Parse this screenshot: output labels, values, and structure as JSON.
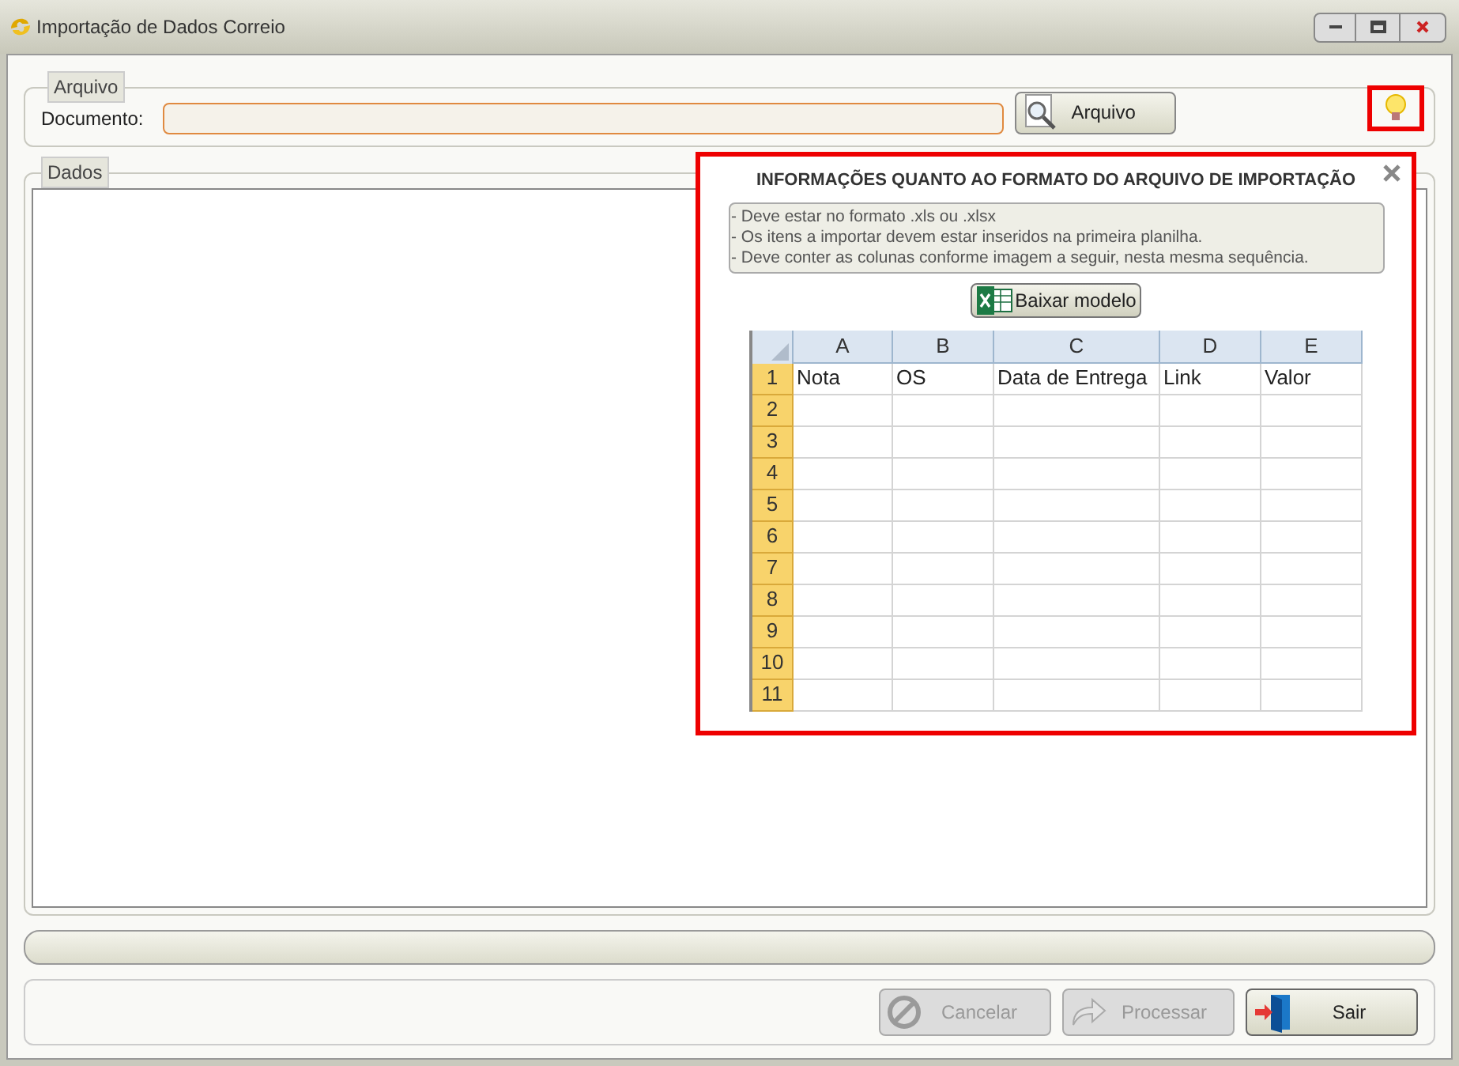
{
  "window": {
    "title": "Importação de Dados Correio"
  },
  "arquivo_group": {
    "legend": "Arquivo",
    "document_label": "Documento:",
    "file_button": {
      "label": "Arquivo",
      "disabled": false
    }
  },
  "dados_group": {
    "legend": "Dados"
  },
  "info_popup": {
    "title": "INFORMAÇÕES QUANTO AO FORMATO DO ARQUIVO DE IMPORTAÇÃO",
    "lines": [
      "- Deve estar no formato .xls ou .xlsx",
      "- Os itens a importar devem estar inseridos na primeira planilha.",
      "- Deve conter as colunas conforme imagem a seguir, nesta mesma sequência."
    ],
    "download_button": "Baixar modelo",
    "sheet": {
      "columns": [
        "A",
        "B",
        "C",
        "D",
        "E"
      ],
      "rows": [
        {
          "number": "1",
          "cells": [
            "Nota",
            "OS",
            "Data de Entrega",
            "Link",
            "Valor"
          ]
        },
        {
          "number": "2"
        },
        {
          "number": "3"
        },
        {
          "number": "4"
        },
        {
          "number": "5"
        },
        {
          "number": "6"
        },
        {
          "number": "7"
        },
        {
          "number": "8"
        },
        {
          "number": "9"
        },
        {
          "number": "10"
        },
        {
          "number": "11"
        }
      ]
    }
  },
  "progress": {
    "level": 0
  },
  "buttons": [
    {
      "kind": "cancel",
      "label": "Cancelar",
      "disabled": true
    },
    {
      "kind": "process",
      "label": "Processar",
      "disabled": true
    },
    {
      "kind": "exit",
      "label": "Sair",
      "disabled": false
    }
  ]
}
